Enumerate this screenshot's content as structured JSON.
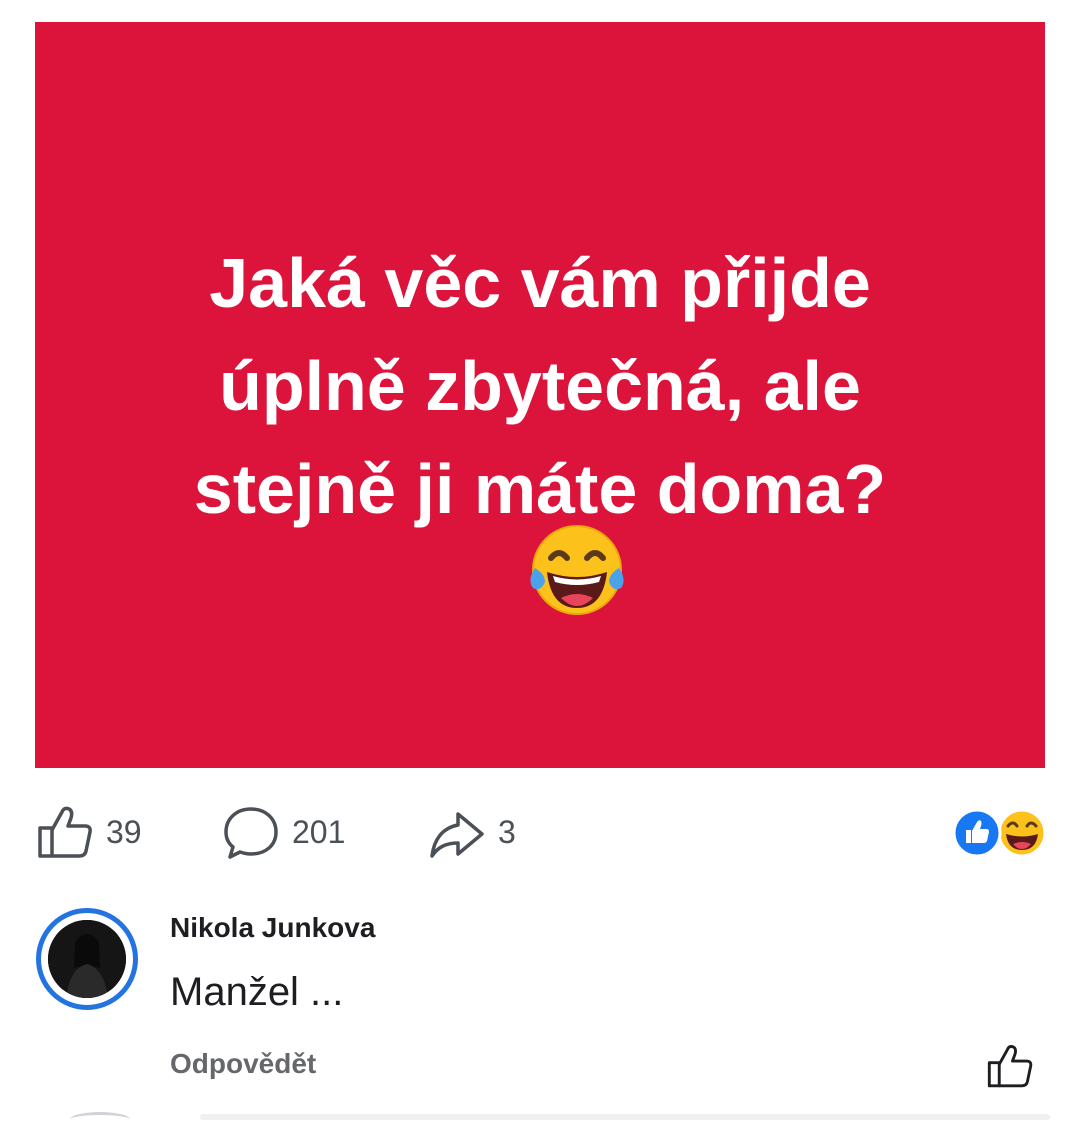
{
  "post": {
    "background_color": "#dc143c",
    "text_lines": [
      "Jaká věc vám přijde",
      "úplně zbytečná, ale",
      "stejně ji máte doma?"
    ],
    "emoji": "laughing-with-tears-icon"
  },
  "actions": {
    "like_count": "39",
    "comment_count": "201",
    "share_count": "3"
  },
  "reactions": [
    "like-reaction-icon",
    "haha-reaction-icon"
  ],
  "comment": {
    "author": "Nikola Junkova",
    "text": "Manžel ...",
    "reply_label": "Odpovědět"
  },
  "colors": {
    "accent_blue": "#2374e1",
    "post_red": "#dc143c",
    "muted_text": "#65676b"
  }
}
